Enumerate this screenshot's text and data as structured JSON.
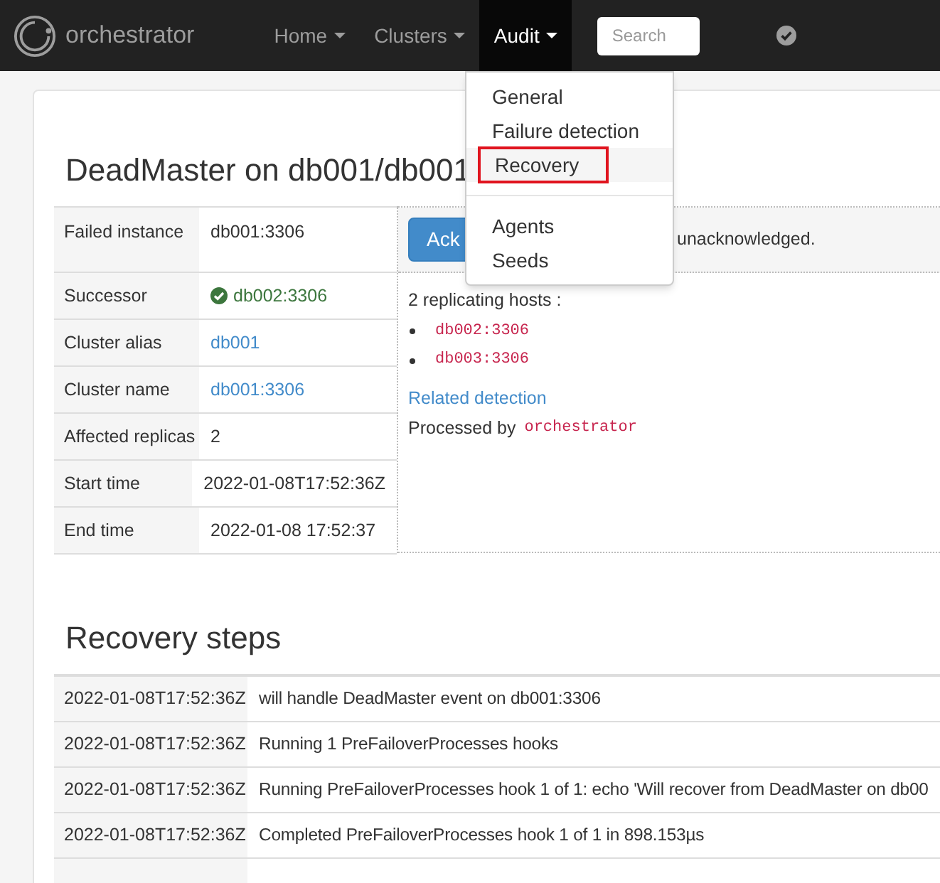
{
  "navbar": {
    "brand": "orchestrator",
    "items": [
      {
        "label": "Home",
        "selected": false
      },
      {
        "label": "Clusters",
        "selected": false
      },
      {
        "label": "Audit",
        "selected": true
      }
    ],
    "search": {
      "placeholder": "Search"
    }
  },
  "audit_menu": {
    "groups": [
      [
        {
          "label": "General",
          "selected": false
        },
        {
          "label": "Failure detection",
          "selected": false
        },
        {
          "label": "Recovery",
          "selected": true
        }
      ],
      [
        {
          "label": "Agents",
          "selected": false
        },
        {
          "label": "Seeds",
          "selected": false
        }
      ]
    ]
  },
  "title": "DeadMaster on db001/db001",
  "details": [
    {
      "label": "Failed instance",
      "value": "db001:3306",
      "kind": "text"
    },
    {
      "label": "Successor",
      "value": "db002:3306",
      "kind": "success"
    },
    {
      "label": "Cluster alias",
      "value": "db001",
      "kind": "link"
    },
    {
      "label": "Cluster name",
      "value": "db001:3306",
      "kind": "link"
    },
    {
      "label": "Affected replicas",
      "value": "2",
      "kind": "text"
    },
    {
      "label": "Start time",
      "value": "2022-01-08T17:52:36Z",
      "kind": "text"
    },
    {
      "label": "End time",
      "value": "2022-01-08 17:52:37",
      "kind": "text"
    }
  ],
  "acknowledge": {
    "button": "Ack",
    "status": "unacknowledged."
  },
  "replicas": {
    "heading": "2 replicating hosts :",
    "hosts": [
      "db002:3306",
      "db003:3306"
    ]
  },
  "related_link": "Related detection",
  "processed_by": {
    "label": "Processed by",
    "value": "orchestrator"
  },
  "steps_title": "Recovery steps",
  "steps": [
    {
      "time": "2022-01-08T17:52:36Z",
      "message": "will handle DeadMaster event on db001:3306"
    },
    {
      "time": "2022-01-08T17:52:36Z",
      "message": "Running 1 PreFailoverProcesses hooks"
    },
    {
      "time": "2022-01-08T17:52:36Z",
      "message": "Running PreFailoverProcesses hook 1 of 1: echo 'Will recover from DeadMaster on db00"
    },
    {
      "time": "2022-01-08T17:52:36Z",
      "message": "Completed PreFailoverProcesses hook 1 of 1 in 898.153µs"
    }
  ]
}
